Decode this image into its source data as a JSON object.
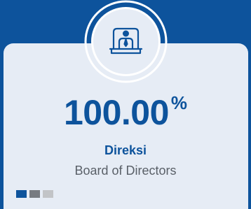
{
  "metric": {
    "value": "100.00",
    "unit": "%",
    "label_id": "Direksi",
    "label_en": "Board of Directors",
    "icon": "boardroom-director-icon"
  },
  "pagination": {
    "dot_colors": [
      "#0d539c",
      "#777b81",
      "#c2c4c7"
    ]
  },
  "colors": {
    "brand": "#0d539c",
    "card_background": "#e6ecf5",
    "secondary_text": "#5a6068"
  }
}
